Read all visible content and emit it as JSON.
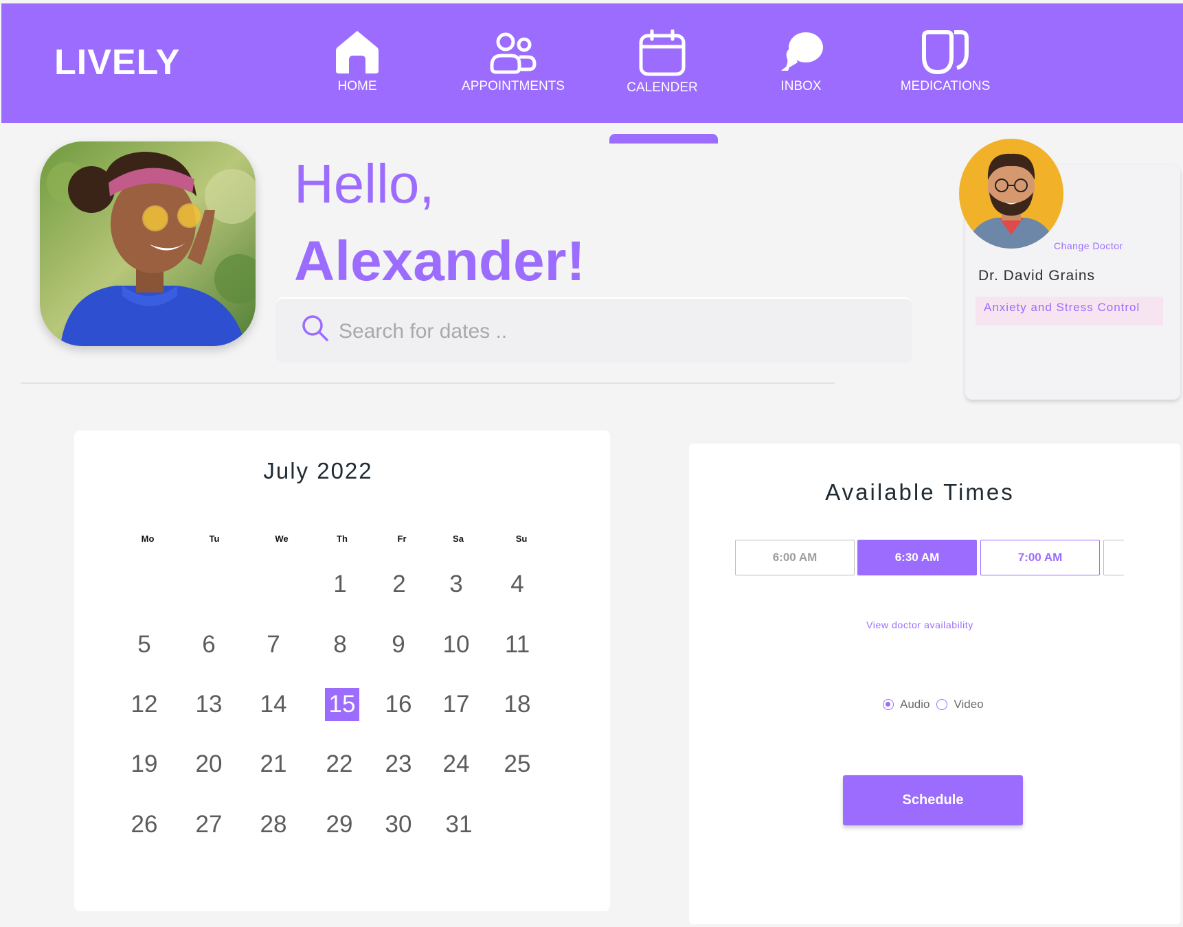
{
  "app": {
    "logo": "LIVELY"
  },
  "nav": [
    {
      "label": "HOME",
      "icon": "home-icon"
    },
    {
      "label": "APPOINTMENTS",
      "icon": "people-icon"
    },
    {
      "label": "CALENDER",
      "icon": "calendar-icon",
      "active": true
    },
    {
      "label": "INBOX",
      "icon": "chat-bubbles-icon"
    },
    {
      "label": "MEDICATIONS",
      "icon": "medication-icon"
    }
  ],
  "greeting": {
    "line1": "Hello,",
    "line2": "Alexander!"
  },
  "search": {
    "placeholder": "Search for dates ..",
    "value": ""
  },
  "doctor": {
    "change_label": "Change Doctor",
    "name": "Dr. David Grains",
    "specialty": "Anxiety and Stress Control"
  },
  "calendar": {
    "title": "July 2022",
    "weekdays": [
      "Mo",
      "Tu",
      "We",
      "Th",
      "Fr",
      "Sa",
      "Su"
    ],
    "days": [
      "1",
      "2",
      "3",
      "4",
      "5",
      "6",
      "7",
      "8",
      "9",
      "10",
      "11",
      "12",
      "13",
      "14",
      "15",
      "16",
      "17",
      "18",
      "19",
      "20",
      "21",
      "22",
      "23",
      "24",
      "25",
      "26",
      "27",
      "28",
      "29",
      "30",
      "31"
    ],
    "selected_day": "15"
  },
  "times": {
    "title": "Available Times",
    "slots": [
      "6:00 AM",
      "6:30 AM",
      "7:00 AM",
      ""
    ],
    "selected_slot": "6:30 AM",
    "view_availability": "View doctor availability",
    "mode_options": [
      "Audio",
      "Video"
    ],
    "selected_mode": "Audio",
    "schedule_label": "Schedule"
  },
  "colors": {
    "accent": "#9b6cfd",
    "tag_bg": "#f6e4f0",
    "background": "#f4f4f4"
  }
}
